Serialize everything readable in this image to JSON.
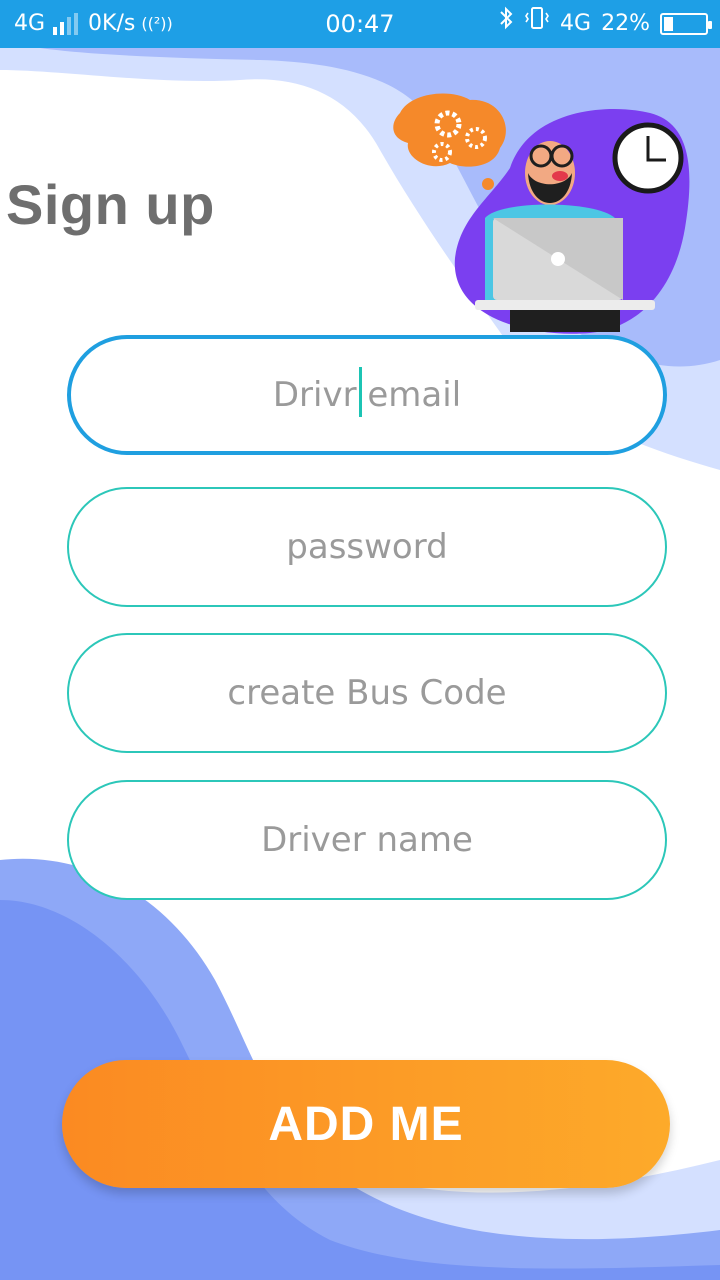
{
  "status_bar": {
    "network": "4G",
    "speed": "0K/s",
    "hotspot": "((²))",
    "time": "00:47",
    "network2": "4G",
    "battery": "22%",
    "battery_level": 0.22
  },
  "page": {
    "title": "Sign up"
  },
  "form": {
    "email_placeholder": "Drivr email",
    "password_placeholder": "password",
    "bus_code_placeholder": "create Bus Code",
    "driver_name_placeholder": "Driver name",
    "submit_label": "ADD ME"
  },
  "colors": {
    "status_bar": "#1e9fe6",
    "field_border": "#2cc7b9",
    "field_focus_border": "#1f9fe0",
    "button_start": "#fb8a22",
    "button_end": "#fdaa2a",
    "blob_light": "#d4e0ff",
    "blob_dark": "#7f9ef5"
  },
  "icons": [
    "signal-icon",
    "hotspot-icon",
    "bluetooth-icon",
    "vibrate-icon",
    "battery-icon",
    "gears-icon",
    "clock-icon",
    "laptop-icon"
  ]
}
